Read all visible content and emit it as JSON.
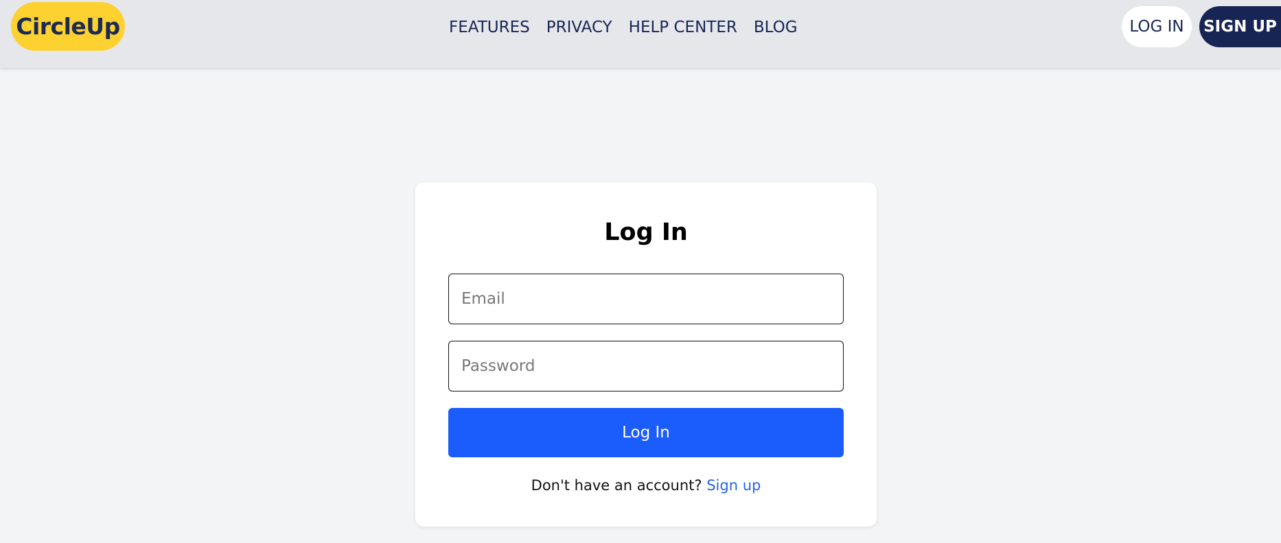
{
  "header": {
    "logo_text": "CircleUp",
    "nav": [
      {
        "label": "FEATURES"
      },
      {
        "label": "PRIVACY"
      },
      {
        "label": "HELP CENTER"
      },
      {
        "label": "BLOG"
      }
    ],
    "login_label": "LOG IN",
    "signup_label": "SIGN UP"
  },
  "login_form": {
    "title": "Log In",
    "email_placeholder": "Email",
    "email_value": "",
    "password_placeholder": "Password",
    "password_value": "",
    "submit_label": "Log In",
    "signup_prompt": "Don't have an account?",
    "signup_link": "Sign up"
  },
  "colors": {
    "logo_bg": "#fdd12f",
    "navy": "#172554",
    "primary_button": "#1a5cfc",
    "link": "#2563eb",
    "header_bg": "#e5e7eb",
    "page_bg": "#f3f4f6"
  }
}
